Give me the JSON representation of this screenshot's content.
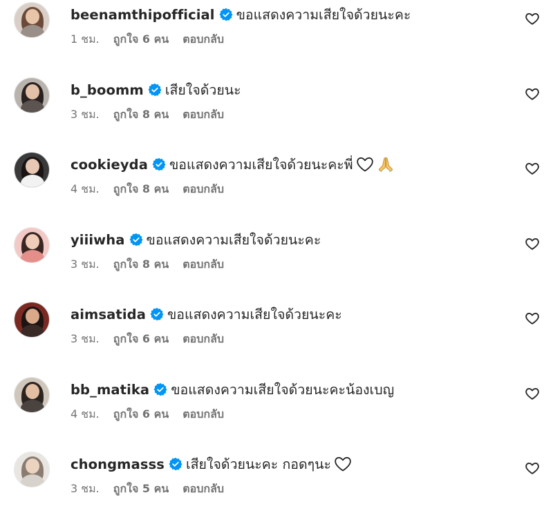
{
  "comments": [
    {
      "username": "beenamthipofficial",
      "text": "ขอแสดงความเสียใจด้วยนะคะ",
      "time": "1 ชม.",
      "likes": "ถูกใจ 6 คน",
      "reply": "ตอบกลับ",
      "avatar_colors": {
        "bg": "#d9cfc7",
        "hair": "#6b4a3a",
        "face": "#e8c4a8",
        "body": "#9a8f88"
      }
    },
    {
      "username": "b_boomm",
      "text": "เสียใจด้วยนะ",
      "time": "3 ชม.",
      "likes": "ถูกใจ 8 คน",
      "reply": "ตอบกลับ",
      "avatar_colors": {
        "bg": "#b9b3ad",
        "hair": "#2a2220",
        "face": "#e3c1a8",
        "body": "#5c5450"
      }
    },
    {
      "username": "cookieyda",
      "text": "ขอแสดงความเสียใจด้วยนะคะพี่ ",
      "time": "4 ชม.",
      "likes": "ถูกใจ 8 คน",
      "reply": "ตอบกลับ",
      "emojis": [
        "white-heart-emoji",
        "folded-hands-emoji"
      ],
      "avatar_colors": {
        "bg": "#3a3a3a",
        "hair": "#1a1414",
        "face": "#e6c8b4",
        "body": "#f2f2f2"
      }
    },
    {
      "username": "yiiiwha",
      "text": "ขอแสดงความเสียใจด้วยนะคะ",
      "time": "3 ชม.",
      "likes": "ถูกใจ 8 คน",
      "reply": "ตอบกลับ",
      "avatar_colors": {
        "bg": "#f3c9c6",
        "hair": "#3a2622",
        "face": "#f0cdb8",
        "body": "#e48f8a"
      }
    },
    {
      "username": "aimsatida",
      "text": "ขอแสดงความเสียใจด้วยนะคะ",
      "time": "3 ชม.",
      "likes": "ถูกใจ 6 คน",
      "reply": "ตอบกลับ",
      "avatar_colors": {
        "bg": "#7a2a22",
        "hair": "#1c1412",
        "face": "#d9a98a",
        "body": "#3a2a26"
      }
    },
    {
      "username": "bb_matika",
      "text": "ขอแสดงความเสียใจด้วยนะคะน้องเบญ",
      "time": "4 ชม.",
      "likes": "ถูกใจ 6 คน",
      "reply": "ตอบกลับ",
      "avatar_colors": {
        "bg": "#cfc6bc",
        "hair": "#2b2420",
        "face": "#e2bfa3",
        "body": "#4a4340"
      }
    },
    {
      "username": "chongmasss",
      "text": "เสียใจด้วยนะคะ กอดๆนะ",
      "time": "3 ชม.",
      "likes": "ถูกใจ 5 คน",
      "reply": "ตอบกลับ",
      "emojis": [
        "white-heart-emoji"
      ],
      "avatar_colors": {
        "bg": "#e9e6e2",
        "hair": "#8a7c70",
        "face": "#ecd3c0",
        "body": "#d8d2cc"
      }
    }
  ],
  "colors": {
    "verified": "#0095f6",
    "text_primary": "#262626",
    "text_secondary": "#737373"
  },
  "icons": {
    "verified": "verified-badge-icon",
    "like": "heart-outline-icon"
  }
}
